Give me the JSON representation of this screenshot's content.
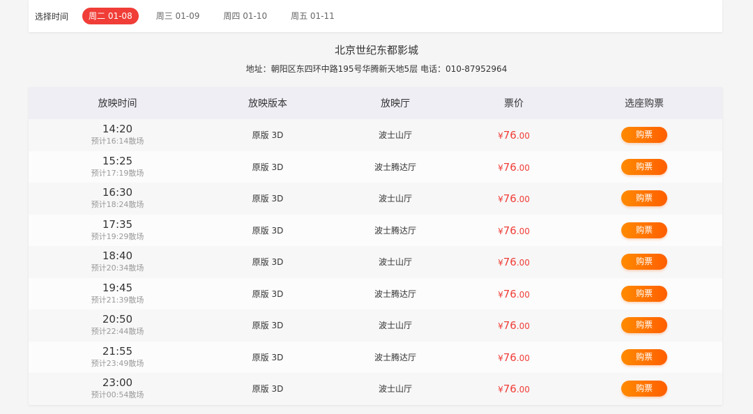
{
  "date_bar": {
    "label": "选择时间",
    "tabs": [
      {
        "label": "周二 01-08",
        "active": true
      },
      {
        "label": "周三 01-09",
        "active": false
      },
      {
        "label": "周四 01-10",
        "active": false
      },
      {
        "label": "周五 01-11",
        "active": false
      }
    ]
  },
  "cinema": {
    "name": "北京世纪东都影城",
    "info": "地址：朝阳区东四环中路195号华腾新天地5层 电话：010-87952964"
  },
  "table": {
    "headers": [
      "放映时间",
      "放映版本",
      "放映厅",
      "票价",
      "选座购票"
    ],
    "rows": [
      {
        "start": "14:20",
        "end": "预计16:14散场",
        "version": "原版 3D",
        "hall": "波士山厅",
        "price_yen": "¥",
        "price_int": "76",
        "price_dec": ".00",
        "buy": "购票"
      },
      {
        "start": "15:25",
        "end": "预计17:19散场",
        "version": "原版 3D",
        "hall": "波士腾达厅",
        "price_yen": "¥",
        "price_int": "76",
        "price_dec": ".00",
        "buy": "购票"
      },
      {
        "start": "16:30",
        "end": "预计18:24散场",
        "version": "原版 3D",
        "hall": "波士山厅",
        "price_yen": "¥",
        "price_int": "76",
        "price_dec": ".00",
        "buy": "购票"
      },
      {
        "start": "17:35",
        "end": "预计19:29散场",
        "version": "原版 3D",
        "hall": "波士腾达厅",
        "price_yen": "¥",
        "price_int": "76",
        "price_dec": ".00",
        "buy": "购票"
      },
      {
        "start": "18:40",
        "end": "预计20:34散场",
        "version": "原版 3D",
        "hall": "波士山厅",
        "price_yen": "¥",
        "price_int": "76",
        "price_dec": ".00",
        "buy": "购票"
      },
      {
        "start": "19:45",
        "end": "预计21:39散场",
        "version": "原版 3D",
        "hall": "波士腾达厅",
        "price_yen": "¥",
        "price_int": "76",
        "price_dec": ".00",
        "buy": "购票"
      },
      {
        "start": "20:50",
        "end": "预计22:44散场",
        "version": "原版 3D",
        "hall": "波士山厅",
        "price_yen": "¥",
        "price_int": "76",
        "price_dec": ".00",
        "buy": "购票"
      },
      {
        "start": "21:55",
        "end": "预计23:49散场",
        "version": "原版 3D",
        "hall": "波士腾达厅",
        "price_yen": "¥",
        "price_int": "76",
        "price_dec": ".00",
        "buy": "购票"
      },
      {
        "start": "23:00",
        "end": "预计00:54散场",
        "version": "原版 3D",
        "hall": "波士山厅",
        "price_yen": "¥",
        "price_int": "76",
        "price_dec": ".00",
        "buy": "购票"
      }
    ]
  },
  "colors": {
    "accent": "#f03d37",
    "button_start": "#ff8a00",
    "button_end": "#ff5f00",
    "header_bg": "#f0eef5"
  }
}
